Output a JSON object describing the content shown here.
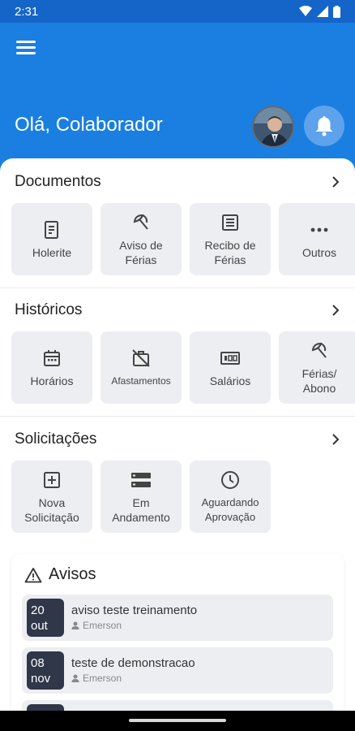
{
  "status_bar": {
    "time": "2:31"
  },
  "header": {
    "greeting_prefix": "Olá, ",
    "user_name": "Colaborador"
  },
  "sections": {
    "documentos": {
      "title": "Documentos",
      "tiles": [
        {
          "label": "Holerite",
          "icon": "receipt-icon"
        },
        {
          "label": "Aviso de\nFérias",
          "icon": "umbrella-icon"
        },
        {
          "label": "Recibo de\nFérias",
          "icon": "document-list-icon"
        },
        {
          "label": "Outros",
          "icon": "more-dots-icon"
        }
      ]
    },
    "historicos": {
      "title": "Históricos",
      "tiles": [
        {
          "label": "Horários",
          "icon": "calendar-icon"
        },
        {
          "label": "Afastamentos",
          "icon": "work-off-icon"
        },
        {
          "label": "Salários",
          "icon": "money-icon"
        },
        {
          "label": "Férias/\nAbono",
          "icon": "umbrella-icon"
        }
      ]
    },
    "solicitacoes": {
      "title": "Solicitações",
      "tiles": [
        {
          "label": "Nova\nSolicitação",
          "icon": "add-box-icon"
        },
        {
          "label": "Em\nAndamento",
          "icon": "storage-icon"
        },
        {
          "label": "Aguardando\nAprovação",
          "icon": "clock-icon"
        }
      ]
    }
  },
  "avisos": {
    "title": "Avisos",
    "items": [
      {
        "day": "20",
        "month": "out",
        "title": "aviso teste treinamento",
        "author": "Emerson"
      },
      {
        "day": "08",
        "month": "nov",
        "title": "teste de demonstracao",
        "author": "Emerson"
      }
    ]
  },
  "colors": {
    "primary": "#1a7fe0",
    "status_bar": "#1565c8",
    "tile_bg": "#eceef1",
    "date_box": "#2f3748"
  }
}
